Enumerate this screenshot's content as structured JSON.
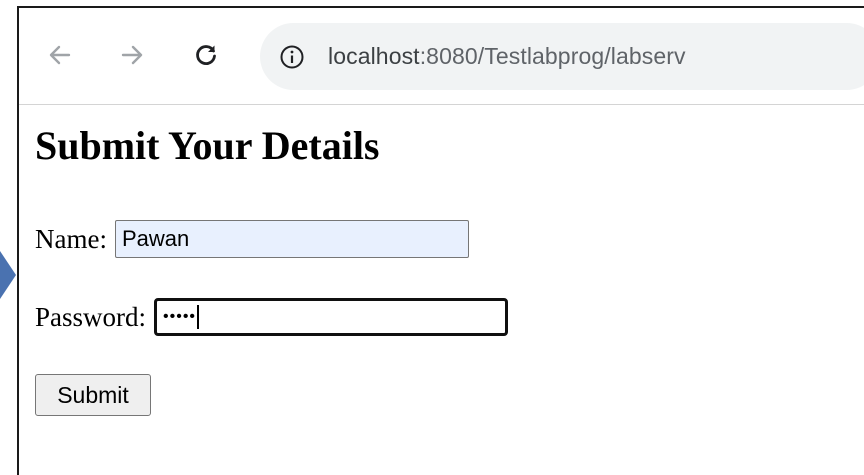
{
  "browser": {
    "back_icon": "arrow-left-icon",
    "forward_icon": "arrow-right-icon",
    "reload_icon": "reload-icon",
    "info_icon": "info-icon",
    "url_host": "localhost",
    "url_rest": ":8080/Testlabprog/labserv"
  },
  "page": {
    "title": "Submit Your Details",
    "name_label": "Name:",
    "name_value": "Pawan",
    "password_label": "Password:",
    "password_mask": "•••••",
    "submit_label": "Submit"
  },
  "colors": {
    "marker_arrow": "#4a72b0",
    "autofill_background": "#e8f0fe",
    "omnibox_background": "#f1f3f4"
  }
}
